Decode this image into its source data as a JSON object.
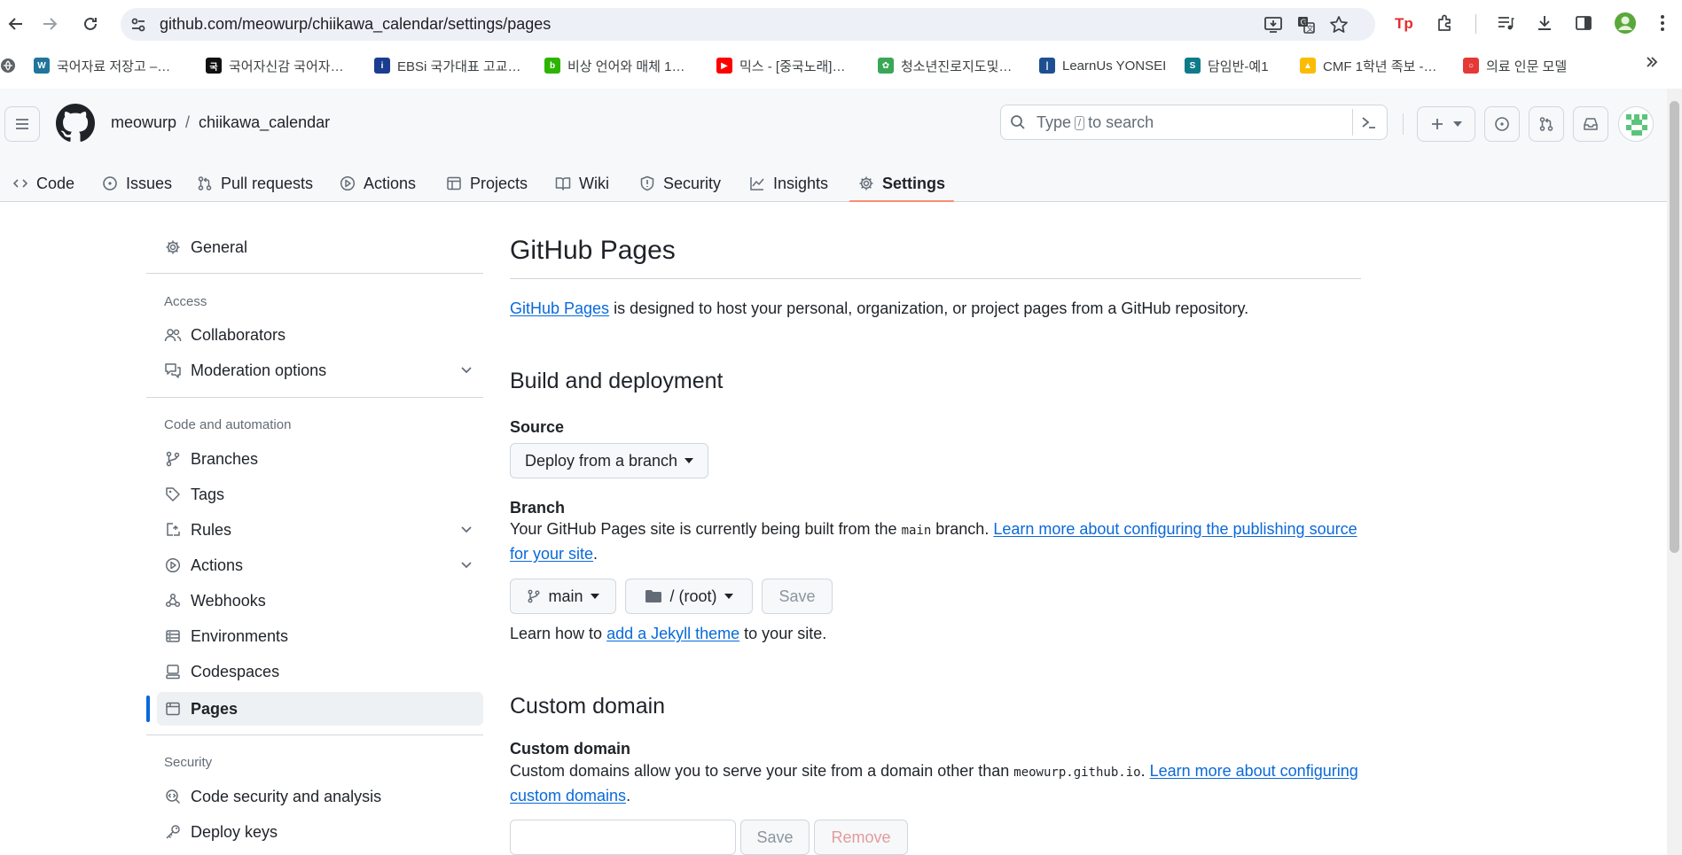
{
  "browser": {
    "url": "github.com/meowurp/chiikawa_calendar/settings/pages",
    "bookmarks": [
      {
        "label": "국어자료 저장고 –…",
        "color": "#21759b",
        "glyph": "W"
      },
      {
        "label": "국어자신감 국어자…",
        "color": "#111111",
        "glyph": "국"
      },
      {
        "label": "EBSi 국가대표 고교…",
        "color": "#1a3d8f",
        "glyph": "i"
      },
      {
        "label": "비상 언어와 매체 1…",
        "color": "#2db400",
        "glyph": "b"
      },
      {
        "label": "믹스 - [중국노래]…",
        "color": "#ff0000",
        "glyph": "▶"
      },
      {
        "label": "청소년진로지도및…",
        "color": "#3aa757",
        "glyph": "✿"
      },
      {
        "label": "LearnUs YONSEI",
        "color": "#1d4f91",
        "glyph": "|"
      },
      {
        "label": "담임반-예1",
        "color": "#0f7b8a",
        "glyph": "S"
      },
      {
        "label": "CMF 1학년 족보 -…",
        "color": "#fbbc04",
        "glyph": "▲"
      },
      {
        "label": "의료 인문 모델",
        "color": "#e53935",
        "glyph": "○"
      }
    ]
  },
  "header": {
    "owner": "meowurp",
    "separator": "/",
    "repo": "chiikawa_calendar",
    "search_prefix": "Type",
    "search_key": "/",
    "search_suffix": "to search"
  },
  "tabs": [
    {
      "label": "Code",
      "icon": "code-icon"
    },
    {
      "label": "Issues",
      "icon": "issue-icon"
    },
    {
      "label": "Pull requests",
      "icon": "pull-request-icon"
    },
    {
      "label": "Actions",
      "icon": "play-icon"
    },
    {
      "label": "Projects",
      "icon": "table-icon"
    },
    {
      "label": "Wiki",
      "icon": "book-icon"
    },
    {
      "label": "Security",
      "icon": "shield-icon"
    },
    {
      "label": "Insights",
      "icon": "graph-icon"
    },
    {
      "label": "Settings",
      "icon": "gear-icon",
      "active": true
    }
  ],
  "sidebar": {
    "general": "General",
    "access_heading": "Access",
    "collaborators": "Collaborators",
    "moderation": "Moderation options",
    "code_heading": "Code and automation",
    "branches": "Branches",
    "tags": "Tags",
    "rules": "Rules",
    "actions": "Actions",
    "webhooks": "Webhooks",
    "environments": "Environments",
    "codespaces": "Codespaces",
    "pages": "Pages",
    "security_heading": "Security",
    "code_security": "Code security and analysis",
    "deploy_keys": "Deploy keys"
  },
  "main": {
    "title": "GitHub Pages",
    "intro_link": "GitHub Pages",
    "intro_text": " is designed to host your personal, organization, or project pages from a GitHub repository.",
    "build_heading": "Build and deployment",
    "source_label": "Source",
    "source_value": "Deploy from a branch",
    "branch_label": "Branch",
    "branch_desc_1": "Your GitHub Pages site is currently being built from the ",
    "branch_desc_code": "main",
    "branch_desc_2": " branch. ",
    "branch_desc_link": "Learn more about configuring the publishing source for your site",
    "branch_desc_end": ".",
    "branch_value": "main",
    "folder_value": "/ (root)",
    "save_label": "Save",
    "jekyll_1": "Learn how to ",
    "jekyll_link": "add a Jekyll theme",
    "jekyll_2": " to your site.",
    "custom_heading": "Custom domain",
    "custom_label": "Custom domain",
    "custom_desc_1": "Custom domains allow you to serve your site from a domain other than ",
    "custom_desc_code": "meowurp.github.io",
    "custom_desc_2": ". ",
    "custom_desc_link": "Learn more about configuring custom domains",
    "custom_desc_end": ".",
    "custom_input_value": "",
    "custom_save": "Save",
    "custom_remove": "Remove"
  }
}
